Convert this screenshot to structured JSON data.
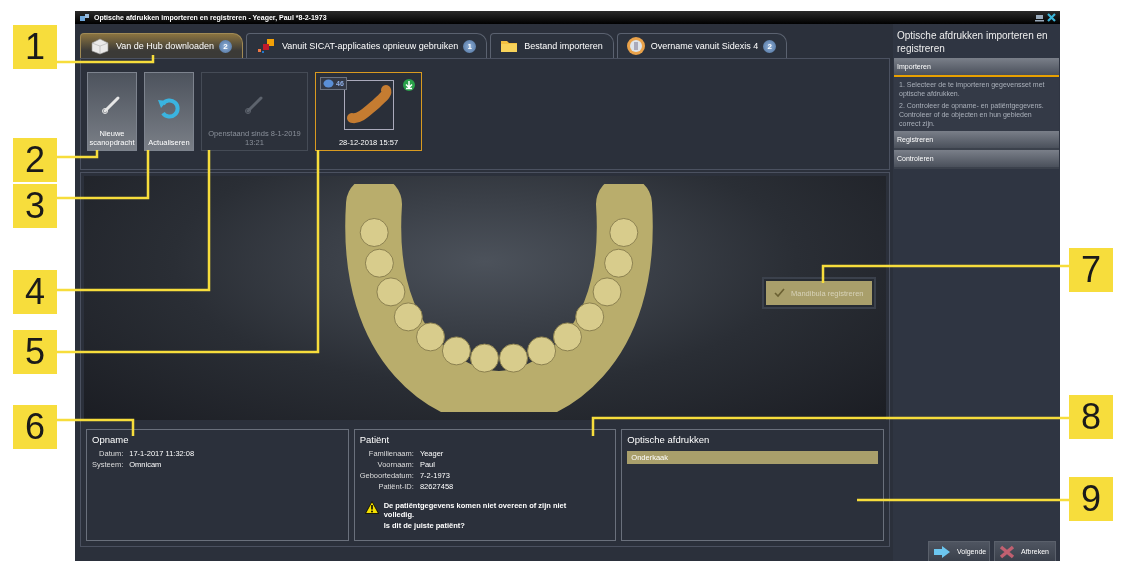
{
  "window": {
    "title": "Optische afdrukken importeren en registreren - Yeager, Paul *8-2-1973"
  },
  "tabs": [
    {
      "kind": "hub",
      "label": "Van de Hub downloaden",
      "badge": "2",
      "selected": true
    },
    {
      "kind": "sicat",
      "label": "Vanuit SICAT-applicaties opnieuw gebruiken",
      "badge": "1",
      "selected": false
    },
    {
      "kind": "file",
      "label": "Bestand importeren",
      "selected": false
    },
    {
      "kind": "sidexis",
      "label": "Overname vanuit Sidexis 4",
      "badge": "2",
      "selected": false
    }
  ],
  "tiles": [
    {
      "kind": "new",
      "label": "Nieuwe scanopdracht",
      "disabled": false,
      "selected": false
    },
    {
      "kind": "refresh",
      "label": "Actualiseren",
      "disabled": false,
      "selected": false
    },
    {
      "kind": "pending",
      "label": "Openstaand sinds 8-1-2019 13:21",
      "disabled": true,
      "selected": false
    },
    {
      "kind": "scan",
      "label": "28-12-2018 15:57",
      "count": "46",
      "disabled": false,
      "selected": true
    }
  ],
  "viewer": {
    "register_button": {
      "label": "Mandibula registreren",
      "checked": true
    }
  },
  "recording": {
    "title": "Opname",
    "fields": [
      {
        "label": "Datum:",
        "value": "17-1-2017 11:32:08"
      },
      {
        "label": "Systeem:",
        "value": "Omnicam"
      }
    ]
  },
  "patient": {
    "title": "Patiënt",
    "fields": [
      {
        "label": "Familienaam:",
        "value": "Yeager"
      },
      {
        "label": "Voornaam:",
        "value": "Paul"
      },
      {
        "label": "Geboortedatum:",
        "value": "7-2-1973"
      },
      {
        "label": "Patiënt-ID:",
        "value": "82627458"
      }
    ],
    "warning": [
      "De patiëntgegevens komen niet overeen of zijn niet volledig.",
      "Is dit de juiste patiënt?"
    ]
  },
  "impressions": {
    "title": "Optische afdrukken",
    "items": [
      {
        "label": "Onderkaak",
        "selected": true
      }
    ]
  },
  "sidebar": {
    "title": "Optische afdrukken importeren en registreren",
    "sections": [
      {
        "label": "Importeren",
        "expanded": true,
        "steps": [
          "1. Selecteer de te importeren gegevensset met optische afdrukken.",
          "2. Controleer de opname- en patiëntgegevens. Controleer of de objecten en hun gebieden correct zijn."
        ]
      },
      {
        "label": "Registreren",
        "expanded": false
      },
      {
        "label": "Controleren",
        "expanded": false
      }
    ]
  },
  "buttons": [
    {
      "kind": "next",
      "label": "Volgende"
    },
    {
      "kind": "cancel",
      "label": "Afbreken"
    }
  ],
  "callouts": [
    "1",
    "2",
    "3",
    "4",
    "5",
    "6",
    "7",
    "8",
    "9"
  ]
}
